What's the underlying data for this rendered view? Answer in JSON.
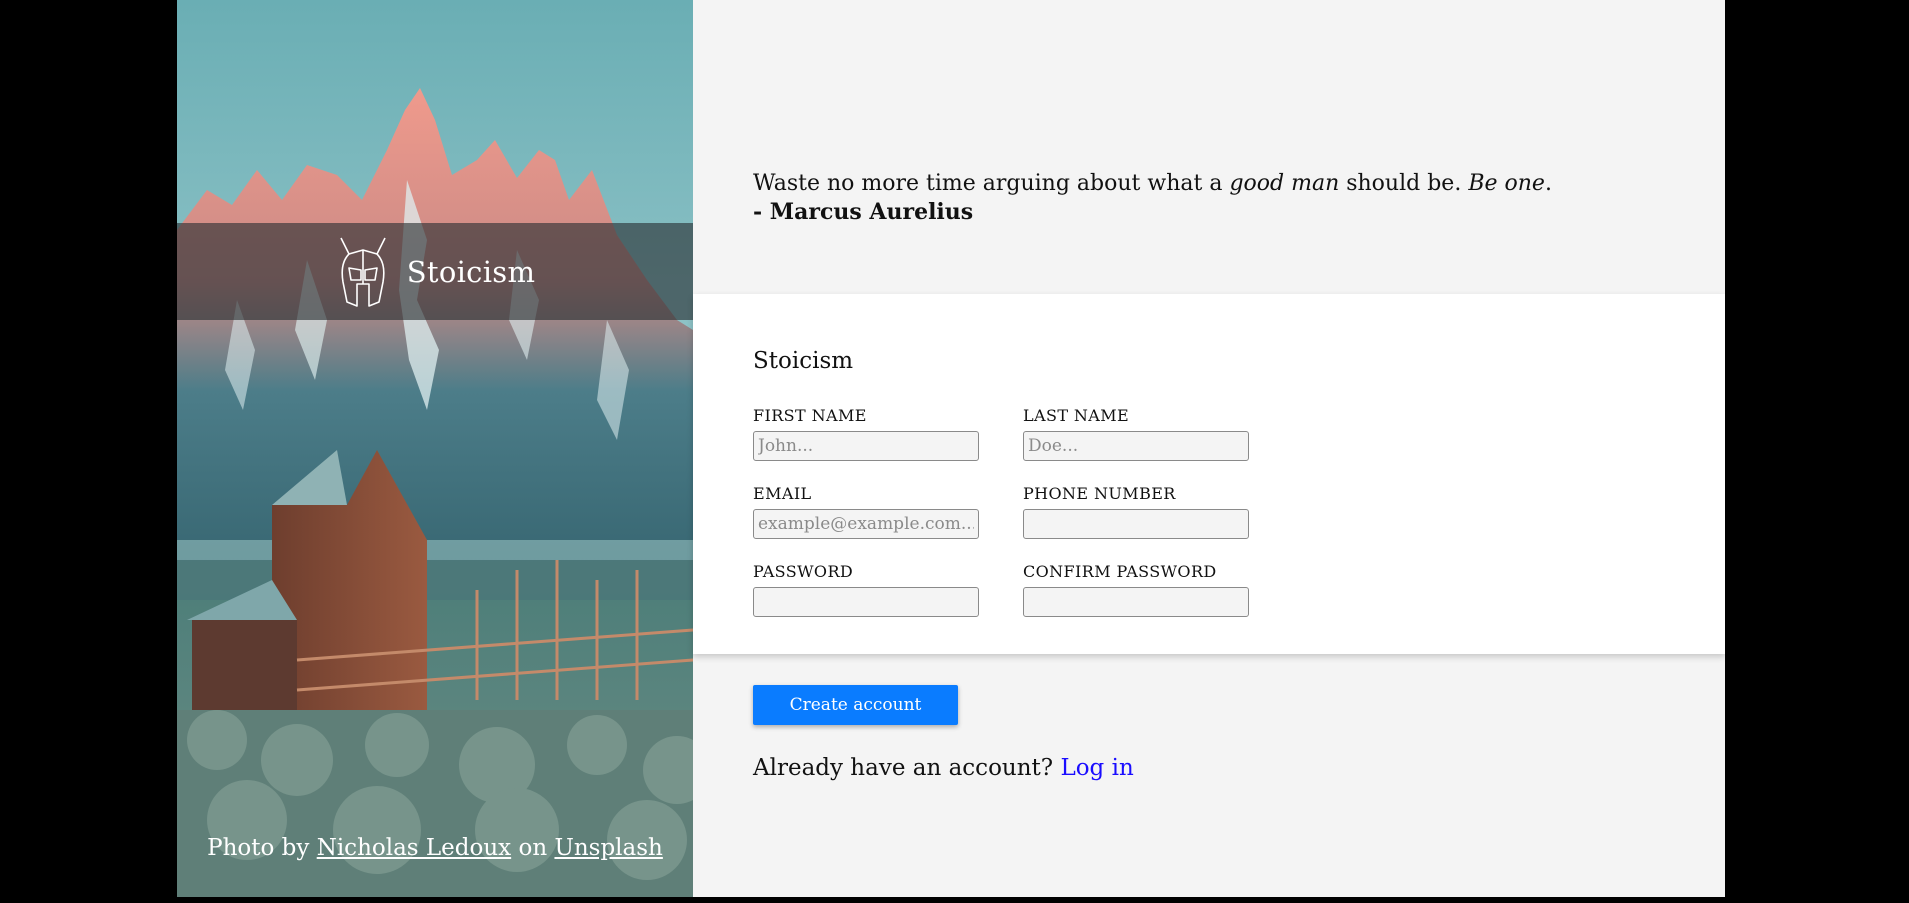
{
  "brand": {
    "name": "Stoicism",
    "logo_icon": "spartan-helmet-icon"
  },
  "photo_credit": {
    "prefix": "Photo by",
    "author": "Nicholas Ledoux",
    "middle": "on",
    "site": "Unsplash"
  },
  "quote": {
    "part1": "Waste no more time arguing about what a ",
    "emphasis1": "good man",
    "part2": " should be. ",
    "emphasis2": "Be one",
    "part3": ".",
    "author": "- Marcus Aurelius"
  },
  "form": {
    "title": "Stoicism",
    "first_name": {
      "label": "FIRST NAME",
      "placeholder": "John...",
      "value": ""
    },
    "last_name": {
      "label": "LAST NAME",
      "placeholder": "Doe...",
      "value": ""
    },
    "email": {
      "label": "EMAIL",
      "placeholder": "example@example.com...",
      "value": ""
    },
    "phone": {
      "label": "PHONE NUMBER",
      "placeholder": "",
      "value": ""
    },
    "password": {
      "label": "PASSWORD",
      "placeholder": "",
      "value": ""
    },
    "confirm_password": {
      "label": "CONFIRM PASSWORD",
      "placeholder": "",
      "value": ""
    },
    "submit_label": "Create account"
  },
  "login": {
    "prompt": "Already have an account?",
    "link_label": "Log in"
  },
  "colors": {
    "accent": "#0a7cff",
    "link": "#1a0dff",
    "panel_bg": "#f4f4f4"
  }
}
